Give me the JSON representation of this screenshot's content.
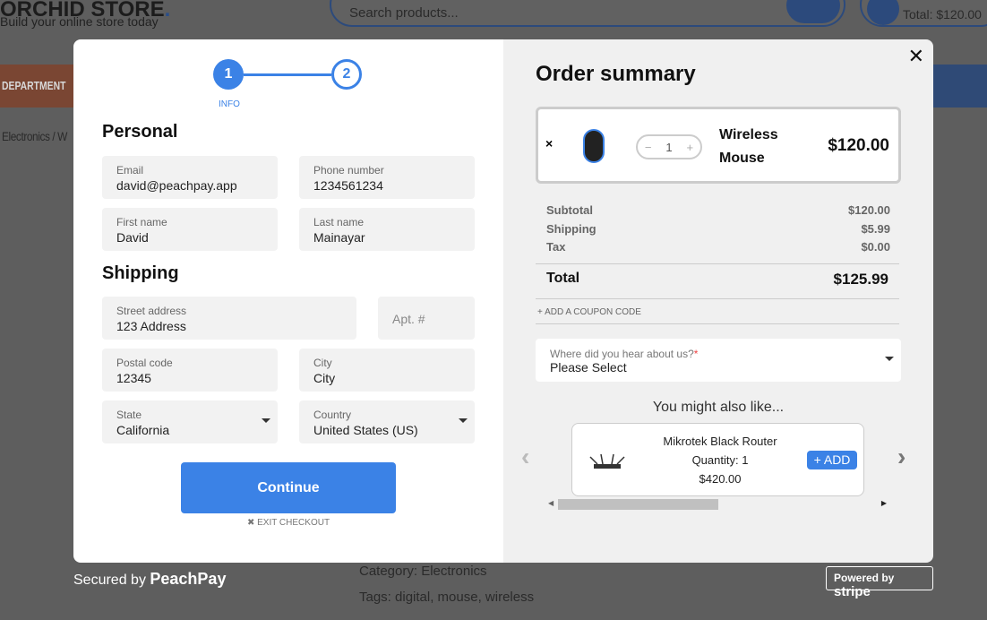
{
  "background": {
    "logo": "ORCHID STORE",
    "tagline": "Build your online store today",
    "search_placeholder": "Search products...",
    "cart_total": "Total: $120.00",
    "department": "DEPARTMENT",
    "breadcrumb": "Electronics / W",
    "category": "Category: Electronics",
    "tags": "Tags: digital, mouse, wireless"
  },
  "steps": [
    {
      "num": "1",
      "label": "INFO",
      "active": true
    },
    {
      "num": "2"
    }
  ],
  "personal": {
    "heading": "Personal",
    "email": {
      "label": "Email",
      "value": "david@peachpay.app"
    },
    "phone": {
      "label": "Phone number",
      "value": "1234561234"
    },
    "first": {
      "label": "First name",
      "value": "David"
    },
    "last": {
      "label": "Last name",
      "value": "Mainayar"
    }
  },
  "shipping": {
    "heading": "Shipping",
    "street": {
      "label": "Street address",
      "value": "123 Address"
    },
    "apt": {
      "placeholder": "Apt. #"
    },
    "postal": {
      "label": "Postal code",
      "value": "12345"
    },
    "city": {
      "label": "City",
      "value": "City"
    },
    "state": {
      "label": "State",
      "value": "California"
    },
    "country": {
      "label": "Country",
      "value": "United States (US)"
    }
  },
  "continue_label": "Continue",
  "exit_label": "EXIT CHECKOUT",
  "summary": {
    "title": "Order summary",
    "item": {
      "remove": "×",
      "name_line1": "Wireless",
      "name_line2": "Mouse",
      "qty": "1",
      "price": "$120.00"
    },
    "subtotal": {
      "label": "Subtotal",
      "value": "$120.00"
    },
    "shipping": {
      "label": "Shipping",
      "value": "$5.99"
    },
    "tax": {
      "label": "Tax",
      "value": "$0.00"
    },
    "total": {
      "label": "Total",
      "value": "$125.99"
    },
    "coupon": "+ ADD A COUPON CODE",
    "hear": {
      "label": "Where did you hear about us?",
      "required": "*",
      "value": "Please Select"
    },
    "also": "You might also like...",
    "rec": {
      "name": "Mikrotek Black Router",
      "qty": "Quantity: 1",
      "price": "$420.00",
      "add": "+ ADD"
    }
  },
  "footer": {
    "secured": "Secured by",
    "peachpay": "PeachPay",
    "powered": "Powered by",
    "stripe": "stripe"
  },
  "colors": {
    "accent": "#3b82e6"
  }
}
